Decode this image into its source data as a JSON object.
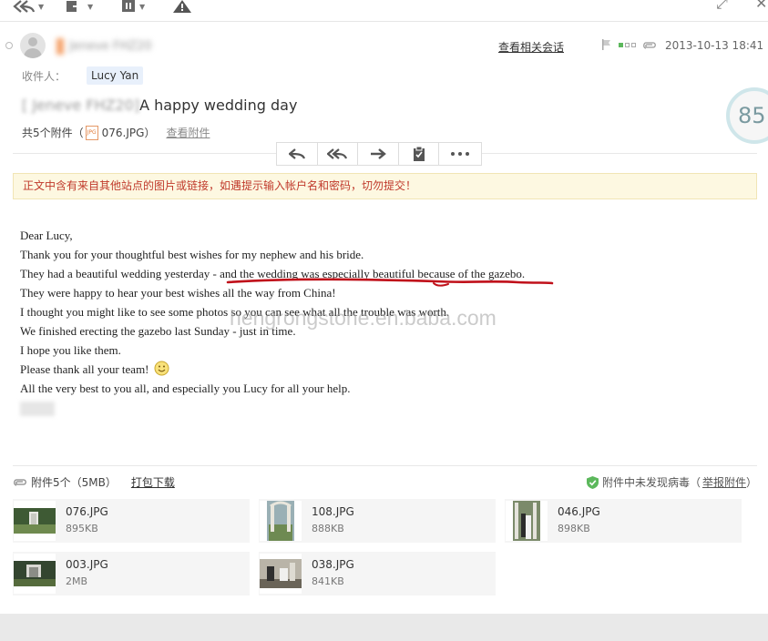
{
  "header": {
    "related_link": "查看相关会话",
    "date": "2013-10-13 18:41",
    "sender_blurred": "Jeneve FHZ20"
  },
  "recipient": {
    "label": "收件人：",
    "name": "Lucy Yan"
  },
  "subject": {
    "blurred_prefix": "[ Jeneve FHZ20]",
    "text": "A happy wedding day"
  },
  "attachments_summary": {
    "prefix": "共5个附件（",
    "file": "076.JPG",
    "suffix": "）",
    "view_link": "查看附件"
  },
  "score": "85",
  "warning": "正文中含有来自其他站点的图片或链接，如遇提示输入帐户名和密码，切勿提交！",
  "body": {
    "lines": [
      "Dear Lucy,",
      "Thank you for your thoughtful best wishes for my nephew and his bride.",
      "They had a beautiful wedding yesterday - and the wedding was especially beautiful because of the gazebo.",
      "They were happy to hear your best wishes all the way from China!",
      "I thought you might like to see some photos so you can see what all the trouble was worth.",
      "We finished erecting the gazebo last Sunday - just in time.",
      "I hope you like them.",
      "Please thank all your team!",
      "All the very best to you all, and especially you Lucy for all your help."
    ]
  },
  "watermark": "hengrongstone.en.baba.com",
  "attachments": {
    "header_label": "附件5个（5MB）",
    "pack_download": "打包下载",
    "virus_text": "附件中未发现病毒（",
    "report_link": "举报附件",
    "virus_suffix": "）",
    "files": [
      {
        "name": "076.JPG",
        "size": "895KB"
      },
      {
        "name": "108.JPG",
        "size": "888KB"
      },
      {
        "name": "046.JPG",
        "size": "898KB"
      },
      {
        "name": "003.JPG",
        "size": "2MB"
      },
      {
        "name": "038.JPG",
        "size": "841KB"
      }
    ]
  },
  "colors": {
    "warning_text": "#c0392b",
    "warning_bg": "#fdf8e1",
    "underline_red": "#c0101a",
    "chip_bg": "#e8f0fb"
  }
}
